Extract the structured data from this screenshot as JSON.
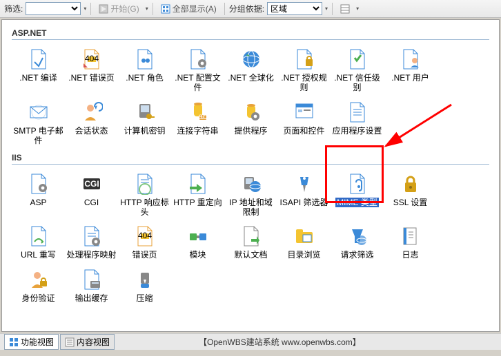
{
  "toolbar": {
    "filter_label": "筛选:",
    "start_label": "开始(G)",
    "showall_label": "全部显示(A)",
    "groupby_label": "分组依据:",
    "groupby_value": "区域"
  },
  "groups": [
    {
      "title": "ASP.NET",
      "items": [
        {
          "id": "net-compile",
          "label": ".NET 编译"
        },
        {
          "id": "net-errors",
          "label": ".NET 错误页"
        },
        {
          "id": "net-roles",
          "label": ".NET 角色"
        },
        {
          "id": "net-config",
          "label": ".NET 配置文件"
        },
        {
          "id": "net-global",
          "label": ".NET 全球化"
        },
        {
          "id": "net-auth",
          "label": ".NET 授权规则"
        },
        {
          "id": "net-trust",
          "label": ".NET 信任级别"
        },
        {
          "id": "net-users",
          "label": ".NET 用户"
        },
        {
          "id": "smtp",
          "label": "SMTP 电子邮件"
        },
        {
          "id": "session",
          "label": "会话状态"
        },
        {
          "id": "machine-key",
          "label": "计算机密钥"
        },
        {
          "id": "conn-str",
          "label": "连接字符串"
        },
        {
          "id": "providers",
          "label": "提供程序"
        },
        {
          "id": "pages-ctrls",
          "label": "页面和控件"
        },
        {
          "id": "app-settings",
          "label": "应用程序设置"
        }
      ]
    },
    {
      "title": "IIS",
      "items": [
        {
          "id": "asp",
          "label": "ASP"
        },
        {
          "id": "cgi",
          "label": "CGI"
        },
        {
          "id": "http-resp",
          "label": "HTTP 响应标头"
        },
        {
          "id": "http-redir",
          "label": "HTTP 重定向"
        },
        {
          "id": "ip-domain",
          "label": "IP 地址和域限制"
        },
        {
          "id": "isapi",
          "label": "ISAPI 筛选器"
        },
        {
          "id": "mime",
          "label": "MIME 类型",
          "selected": true
        },
        {
          "id": "ssl",
          "label": "SSL 设置"
        },
        {
          "id": "url-rewrite",
          "label": "URL 重写"
        },
        {
          "id": "handlers",
          "label": "处理程序映射"
        },
        {
          "id": "error-pages",
          "label": "错误页"
        },
        {
          "id": "modules",
          "label": "模块"
        },
        {
          "id": "default-doc",
          "label": "默认文档"
        },
        {
          "id": "dir-browse",
          "label": "目录浏览"
        },
        {
          "id": "req-filter",
          "label": "请求筛选"
        },
        {
          "id": "logging",
          "label": "日志"
        },
        {
          "id": "authn",
          "label": "身份验证"
        },
        {
          "id": "output-cache",
          "label": "输出缓存"
        },
        {
          "id": "compression",
          "label": "压缩"
        }
      ]
    }
  ],
  "tabs": {
    "features": "功能视图",
    "content": "内容视图"
  },
  "footer": "【OpenWBS建站系统 www.openwbs.com】",
  "icon_colors": {
    "blue": "#3b8ad8",
    "orange": "#e8a23a",
    "yellow": "#f4c430",
    "green": "#4caf50",
    "red": "#d9534f",
    "gray": "#888",
    "gold": "#d4a017"
  }
}
